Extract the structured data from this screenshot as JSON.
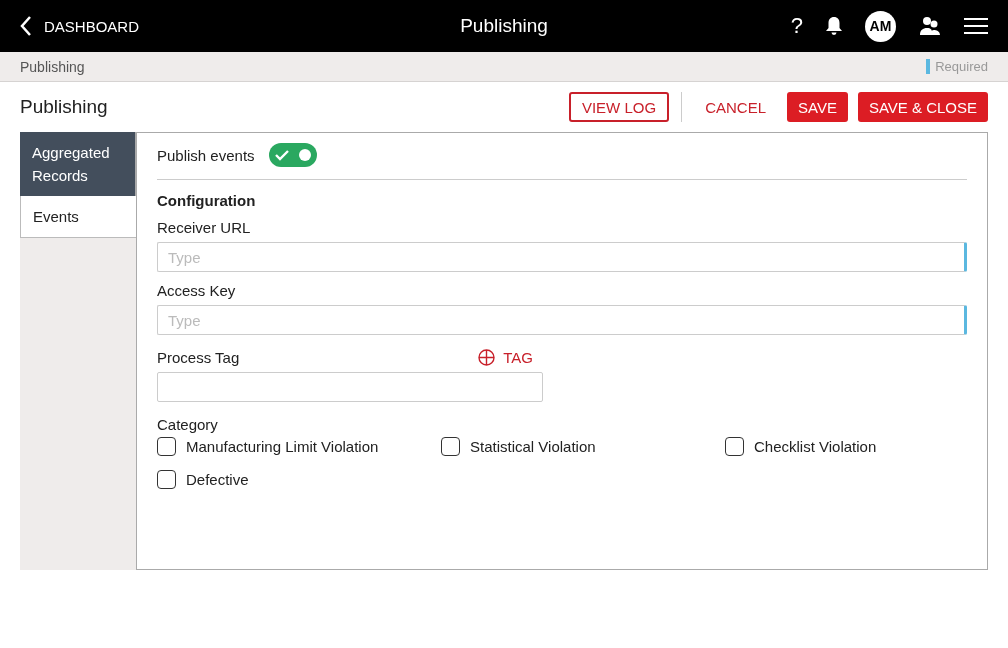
{
  "header": {
    "back_label": "DASHBOARD",
    "title": "Publishing",
    "help": "?",
    "avatar": "AM"
  },
  "breadcrumb": {
    "label": "Publishing",
    "required_legend": "Required"
  },
  "page": {
    "title": "Publishing",
    "buttons": [
      {
        "label": "VIEW LOG",
        "kind": "outline"
      },
      {
        "label": "CANCEL",
        "kind": "text"
      },
      {
        "label": "SAVE",
        "kind": "filled"
      },
      {
        "label": "SAVE & CLOSE",
        "kind": "filled"
      }
    ]
  },
  "tabs": [
    {
      "label": "Aggregated Records",
      "selected": false
    },
    {
      "label": "Events",
      "selected": true
    }
  ],
  "publish": {
    "label": "Publish events",
    "on": true
  },
  "section_title": "Configuration",
  "fields": [
    {
      "label": "Receiver URL",
      "placeholder": "Type",
      "required": true
    },
    {
      "label": "Access Key",
      "placeholder": "Type",
      "required": true
    }
  ],
  "process_tag": {
    "label": "Process Tag",
    "add_label": "TAG"
  },
  "category": {
    "label": "Category",
    "options": [
      {
        "label": "Manufacturing Limit Violation",
        "checked": false
      },
      {
        "label": "Statistical Violation",
        "checked": false
      },
      {
        "label": "Checklist Violation",
        "checked": false
      },
      {
        "label": "Defective",
        "checked": false
      }
    ]
  }
}
